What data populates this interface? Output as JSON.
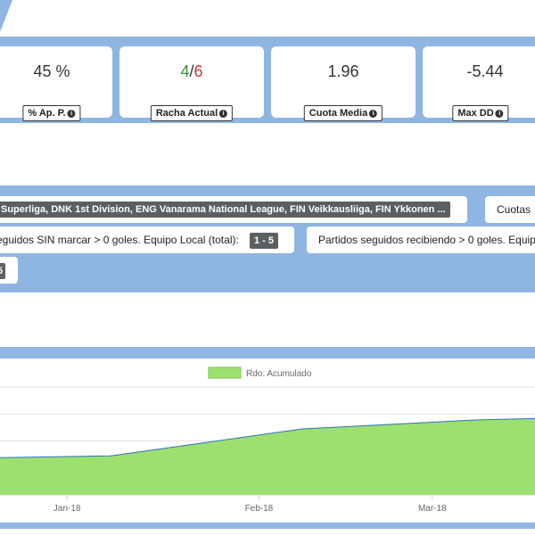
{
  "stats": [
    {
      "name": "ap",
      "value": "45 %",
      "label": "% Ap. P."
    },
    {
      "name": "racha",
      "won": "4",
      "sep": "/",
      "total": "6",
      "label": "Racha Actual"
    },
    {
      "name": "cuota",
      "value": "1.96",
      "label": "Cuota Media"
    },
    {
      "name": "maxdd",
      "value": "-5.44",
      "label": "Max DD"
    }
  ],
  "filters": {
    "leagues": "Superliga, DNK 1st Division, ENG Vanarama National League, FIN Veikkausliiga, FIN Ykkonen ...",
    "odds": "Cuotas",
    "filter1_text": "eguidos SIN marcar > 0 goles. Equipo Local (total):",
    "filter1_tag": "1 - 5",
    "filter2_text": "Partidos seguidos recibiendo > 0 goles. Equipo",
    "filter3_tag": "5"
  },
  "chart_data": {
    "type": "area",
    "series": [
      {
        "name": "Rdo. Acumulado",
        "x": [
          "2017-12-09",
          "2018-01-08",
          "2018-02-08",
          "2018-03-08",
          "2018-03-28"
        ],
        "values": [
          12,
          13,
          22,
          25,
          26
        ]
      }
    ],
    "categories": [
      "Jan-18",
      "Feb-18",
      "Mar-18"
    ],
    "ylim": [
      0,
      36
    ],
    "legend": "top-center",
    "grid": true,
    "colors": {
      "fill": "#9de06f",
      "line": "#2f6fc4"
    }
  }
}
